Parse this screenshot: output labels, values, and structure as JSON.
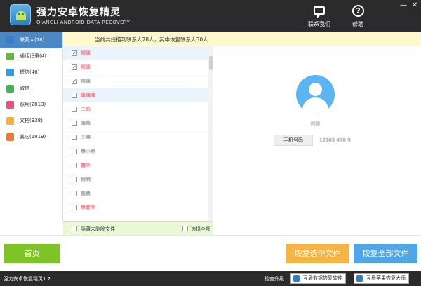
{
  "app": {
    "title": "强力安卓恢复精灵",
    "subtitle": "QIANGLI ANDROID DATA RECOVERY"
  },
  "header": {
    "contact_label": "联系我们",
    "help_label": "帮助",
    "minimize": "—",
    "close": "✕"
  },
  "sidebar": {
    "items": [
      {
        "label": "联系人(78)",
        "color": "#3b7dc4"
      },
      {
        "label": "通话记录(4)",
        "color": "#5dba3e"
      },
      {
        "label": "短信(46)",
        "color": "#2f9ce0"
      },
      {
        "label": "微信",
        "color": "#3fb950"
      },
      {
        "label": "照片(2813)",
        "color": "#e5527a"
      },
      {
        "label": "文档(338)",
        "color": "#f0b33a"
      },
      {
        "label": "其它(1919)",
        "color": "#f07a3a"
      }
    ]
  },
  "summary": "当前共扫描到联系人78人，其中恢复联系人30人",
  "contacts": [
    {
      "name": "阿唐",
      "checked": true,
      "red": true
    },
    {
      "name": "阿唐",
      "checked": true,
      "red": true
    },
    {
      "name": "阿唐",
      "checked": true,
      "red": false
    },
    {
      "name": "唐瑞海",
      "checked": false,
      "red": true
    },
    {
      "name": "二伯",
      "checked": false,
      "red": true
    },
    {
      "name": "海燕",
      "checked": false,
      "red": false
    },
    {
      "name": "王坤",
      "checked": false,
      "red": false
    },
    {
      "name": "林小明",
      "checked": false,
      "red": false
    },
    {
      "name": "魏华",
      "checked": false,
      "red": true
    },
    {
      "name": "树明",
      "checked": false,
      "red": false
    },
    {
      "name": "施勇",
      "checked": false,
      "red": false
    },
    {
      "name": "林爱华",
      "checked": false,
      "red": true
    }
  ],
  "list_footer": {
    "hide_label": "隐藏未删除文件",
    "select_all_label": "选择全部"
  },
  "detail": {
    "name": "阿唐",
    "field_label": "手机号码",
    "field_value": "12365 478 9"
  },
  "buttons": {
    "home": "首页",
    "recover_selected": "恢复选中文件",
    "recover_all": "恢复全部文件"
  },
  "statusbar": {
    "version": "强力安卓恢复精灵1.2",
    "update": "检查升级",
    "link1": "互盾数据恢复软件",
    "link2": "互盾苹果恢复大师"
  }
}
